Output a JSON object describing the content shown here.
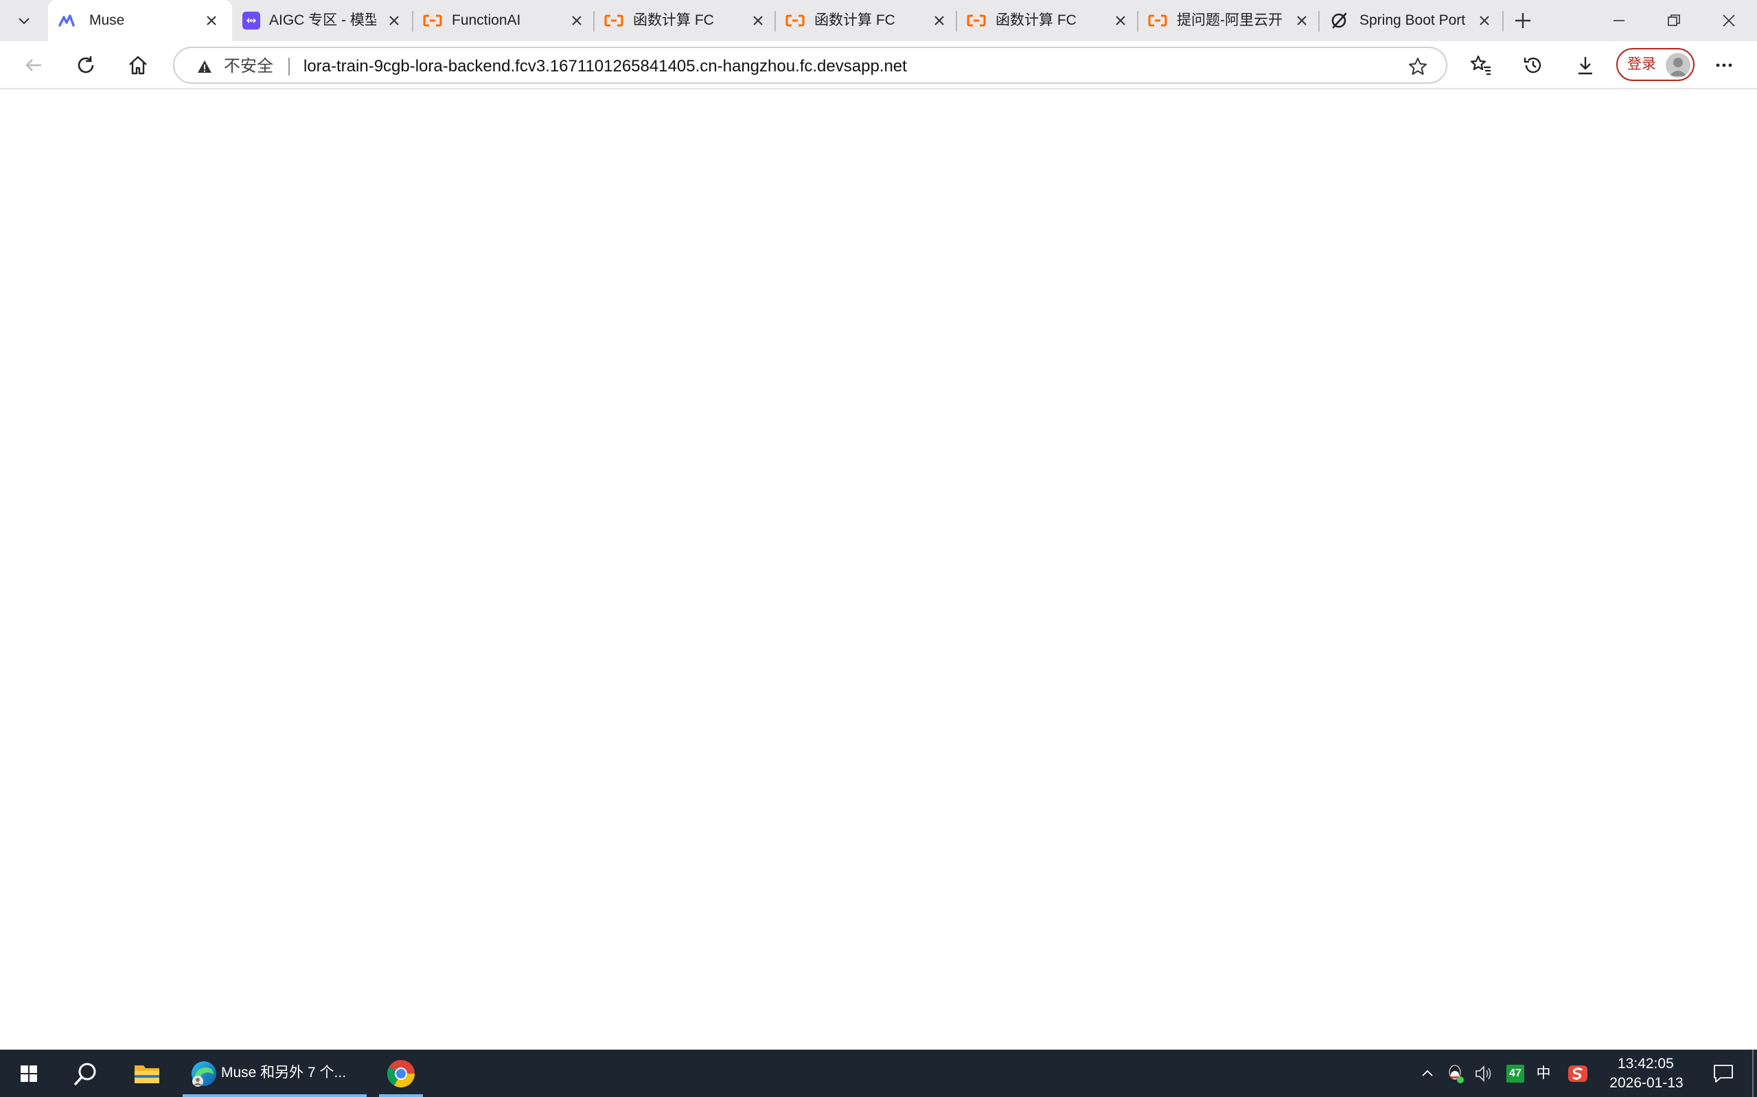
{
  "browser": {
    "tabs": [
      {
        "title": "Muse",
        "favicon": "muse-logo-icon",
        "active": true
      },
      {
        "title": "AIGC 专区 - 模型",
        "favicon": "aigc-logo-icon",
        "active": false
      },
      {
        "title": "FunctionAI",
        "favicon": "aliyun-logo-icon",
        "active": false
      },
      {
        "title": "函数计算 FC",
        "favicon": "aliyun-logo-icon",
        "active": false
      },
      {
        "title": "函数计算 FC",
        "favicon": "aliyun-logo-icon",
        "active": false
      },
      {
        "title": "函数计算 FC",
        "favicon": "aliyun-logo-icon",
        "active": false
      },
      {
        "title": "提问题-阿里云开",
        "favicon": "aliyun-logo-icon",
        "active": false
      },
      {
        "title": "Spring Boot Port",
        "favicon": "spring-logo-icon",
        "active": false
      }
    ],
    "address": {
      "security_label": "不安全",
      "url": "lora-train-9cgb-lora-backend.fcv3.1671101265841405.cn-hangzhou.fc.devsapp.net"
    },
    "login_label": "登录",
    "colors": {
      "aliyun_orange": "#ff6a00",
      "login_red": "#b3261e",
      "tabstrip_bg": "#e9e9eb",
      "taskbar_bg": "#1c2530"
    }
  },
  "taskbar": {
    "edge_task_label": "Muse 和另外 7 个...",
    "tray": {
      "battery_badge": "47",
      "ime_label": "中",
      "time": "13:42:05",
      "date": "2026-01-13"
    }
  }
}
